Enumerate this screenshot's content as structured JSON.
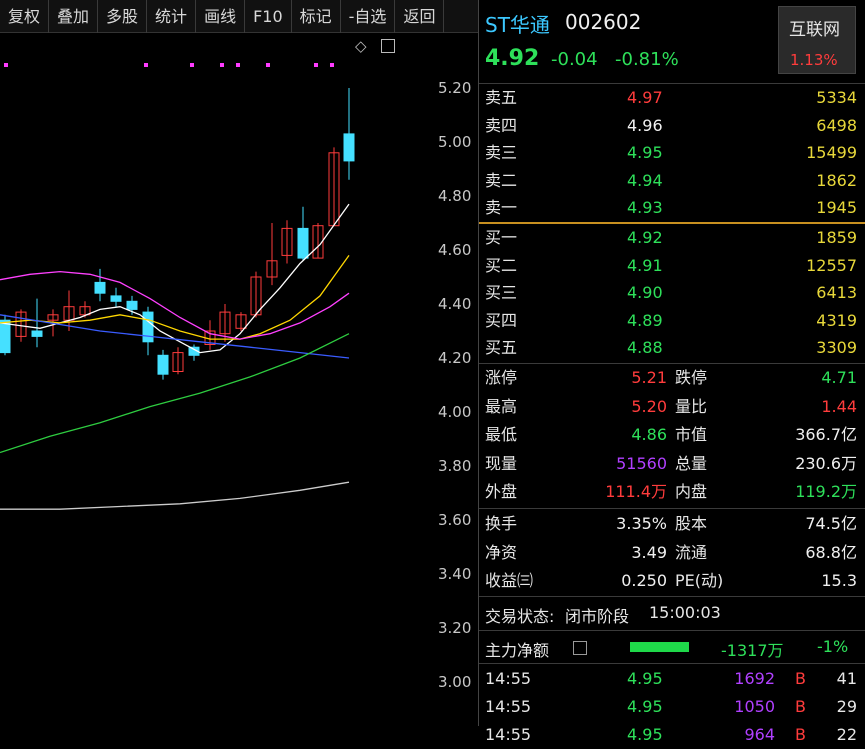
{
  "toolbar": {
    "items": [
      "复权",
      "叠加",
      "多股",
      "统计",
      "画线",
      "F10",
      "标记",
      "-自选",
      "返回"
    ]
  },
  "chart": {
    "price_axis": [
      "5.20",
      "5.00",
      "4.80",
      "4.60",
      "4.40",
      "4.20",
      "4.00",
      "3.80",
      "3.60",
      "3.40",
      "3.20",
      "3.00"
    ],
    "diamond_icon": "◇",
    "window_icon": "▢",
    "colors": {
      "up": "#ff3c3c",
      "down": "#45e0ff",
      "ma5": "#ffffff",
      "ma10": "#ffd700",
      "ma20": "#ff40ff",
      "ma30": "#3a5cff",
      "ma60": "#2ecc40",
      "ma120": "#cccccc",
      "marker": "#ff3cff"
    }
  },
  "stock": {
    "name": "ST华通",
    "code": "002602",
    "price": "4.92",
    "change": "-0.04",
    "change_pct": "-0.81%",
    "sector": "互联网",
    "sector_pct": "1.13%"
  },
  "order_book": {
    "asks": [
      {
        "label": "卖五",
        "price": "4.97",
        "vol": "5334",
        "color": "red"
      },
      {
        "label": "卖四",
        "price": "4.96",
        "vol": "6498",
        "color": "white"
      },
      {
        "label": "卖三",
        "price": "4.95",
        "vol": "15499",
        "color": "green"
      },
      {
        "label": "卖二",
        "price": "4.94",
        "vol": "1862",
        "color": "green"
      },
      {
        "label": "卖一",
        "price": "4.93",
        "vol": "1945",
        "color": "green"
      }
    ],
    "bids": [
      {
        "label": "买一",
        "price": "4.92",
        "vol": "1859",
        "color": "green"
      },
      {
        "label": "买二",
        "price": "4.91",
        "vol": "12557",
        "color": "green"
      },
      {
        "label": "买三",
        "price": "4.90",
        "vol": "6413",
        "color": "green"
      },
      {
        "label": "买四",
        "price": "4.89",
        "vol": "4319",
        "color": "green"
      },
      {
        "label": "买五",
        "price": "4.88",
        "vol": "3309",
        "color": "green"
      }
    ]
  },
  "stats1": [
    {
      "l1": "涨停",
      "v1": "5.21",
      "c1": "red",
      "l2": "跌停",
      "v2": "4.71",
      "c2": "green"
    },
    {
      "l1": "最高",
      "v1": "5.20",
      "c1": "red",
      "l2": "量比",
      "v2": "1.44",
      "c2": "red"
    },
    {
      "l1": "最低",
      "v1": "4.86",
      "c1": "green",
      "l2": "市值",
      "v2": "366.7亿",
      "c2": "white"
    },
    {
      "l1": "现量",
      "v1": "51560",
      "c1": "purple",
      "l2": "总量",
      "v2": "230.6万",
      "c2": "white"
    },
    {
      "l1": "外盘",
      "v1": "111.4万",
      "c1": "red",
      "l2": "内盘",
      "v2": "119.2万",
      "c2": "green"
    }
  ],
  "stats2": [
    {
      "l1": "换手",
      "v1": "3.35%",
      "l2": "股本",
      "v2": "74.5亿"
    },
    {
      "l1": "净资",
      "v1": "3.49",
      "l2": "流通",
      "v2": "68.8亿"
    },
    {
      "l1": "收益㈢",
      "v1": "0.250",
      "l2": "PE(动)",
      "v2": "15.3"
    }
  ],
  "trade_status": {
    "label": "交易状态:",
    "value": "闭市阶段",
    "time": "15:00:03"
  },
  "main_flow": {
    "label": "主力净额",
    "amount": "-1317万",
    "pct": "-1%",
    "fill_fraction": 0.9
  },
  "ticks": [
    {
      "time": "14:55",
      "price": "4.95",
      "vol": "1692",
      "bs": "B",
      "count": "41"
    },
    {
      "time": "14:55",
      "price": "4.95",
      "vol": "1050",
      "bs": "B",
      "count": "29"
    },
    {
      "time": "14:55",
      "price": "4.95",
      "vol": "964",
      "bs": "B",
      "count": "22"
    }
  ]
}
